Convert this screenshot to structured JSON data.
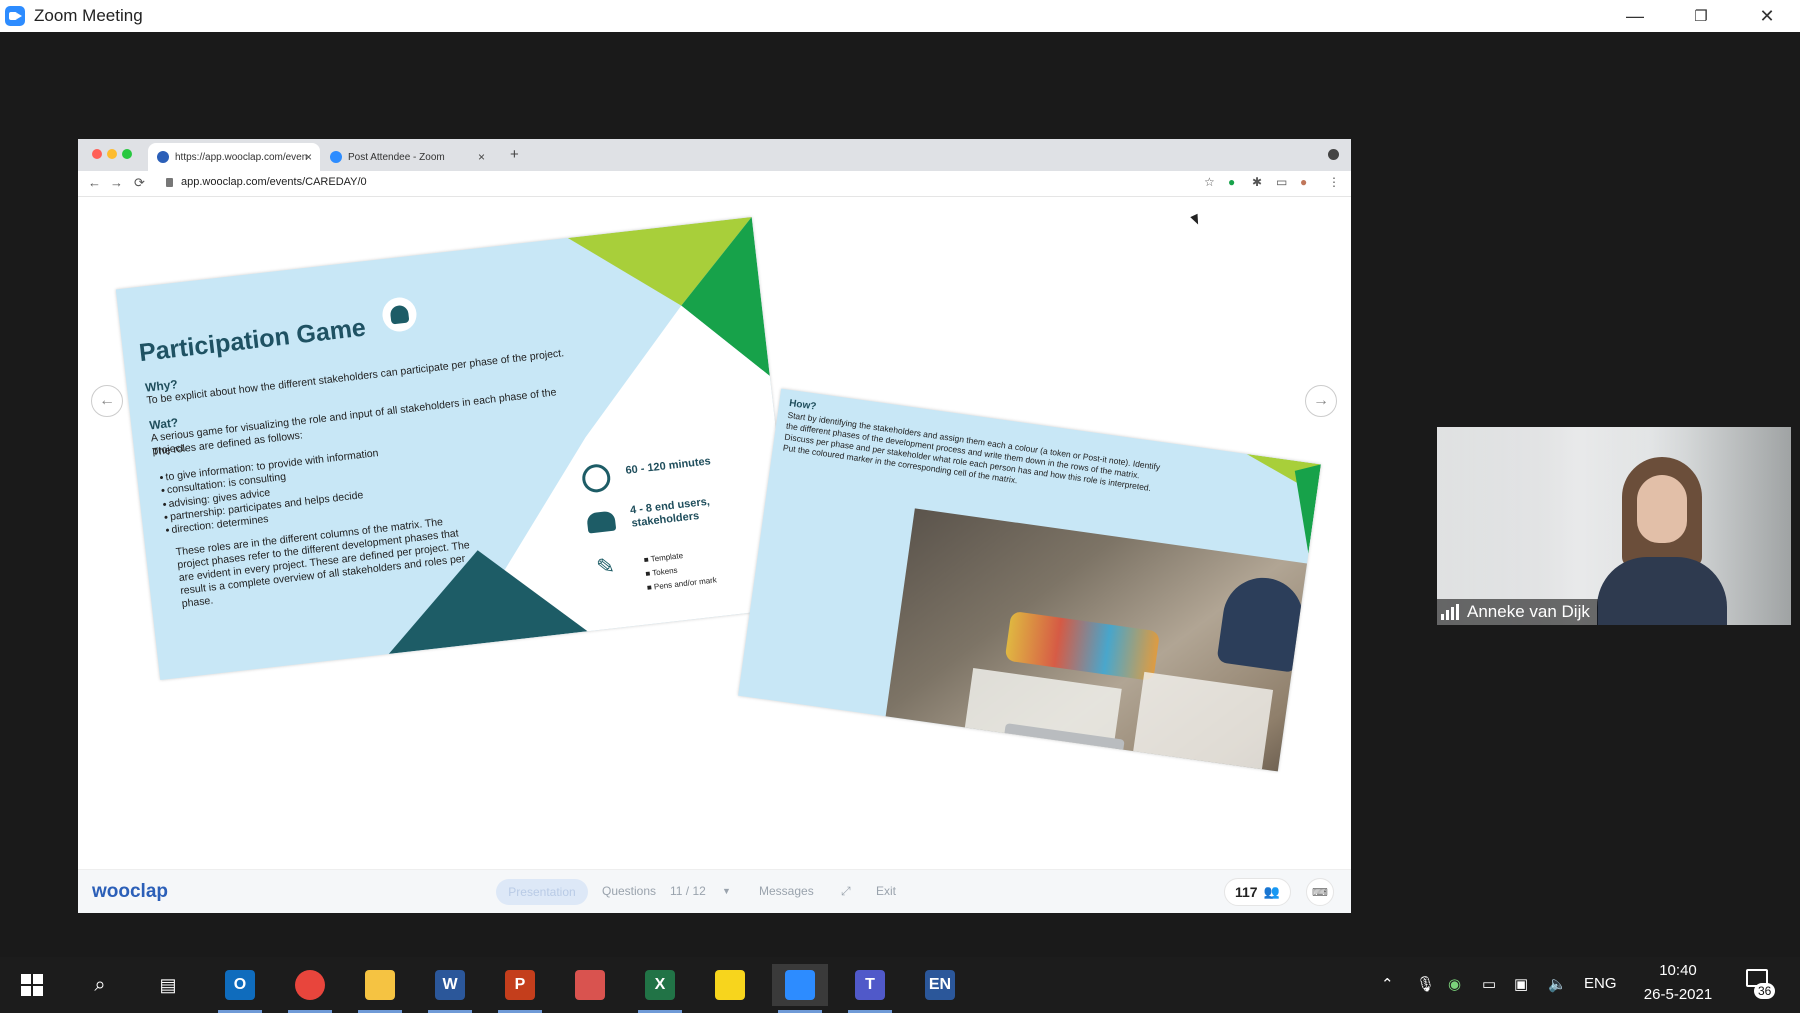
{
  "window": {
    "title": "Zoom Meeting",
    "minimize": "—",
    "restore": "❐",
    "close": "✕"
  },
  "browser": {
    "tabs": [
      {
        "label": "https://app.wooclap.com/even",
        "close": "×"
      },
      {
        "label": "Post Attendee - Zoom",
        "close": "×"
      }
    ],
    "new_tab": "+",
    "url": "app.wooclap.com/events/CAREDAY/0",
    "nav": {
      "back": "←",
      "forward": "→",
      "reload": "⟳"
    }
  },
  "slide1": {
    "title": "Participation Game",
    "why_title": "Why?",
    "why_text": "To be explicit about how the different stakeholders can participate per phase of the project.",
    "wat_title": "Wat?",
    "wat_text1": "A serious game for visualizing the role and input of all stakeholders in each phase of the project.",
    "wat_text2": "The roles are defined as follows:",
    "roles": [
      "to give information: to provide with information",
      "consultation: is consulting",
      "advising: gives advice",
      "partnership: participates and helps decide",
      "direction: determines"
    ],
    "matrix_text": "These roles are in the different columns of the matrix. The project phases refer to the different development phases that are evident in every project. These are defined per project. The result is a complete overview of all stakeholders and roles per phase.",
    "duration": "60 - 120 minutes",
    "users": "4 - 8 end users, stakeholders",
    "materials": [
      "Template",
      "Tokens",
      "Pens and/or mark"
    ]
  },
  "slide2": {
    "how_title": "How?",
    "how_text": "Start by identifying the stakeholders and assign them each a colour (a token or Post-it note). Identify the different phases of the development process and write them down in the rows of the matrix. Discuss per phase and per stakeholder what role each person has and how this role is interpreted. Put the coloured marker in the corresponding cell of the matrix."
  },
  "wooclap_bar": {
    "logo": "wooclap",
    "presentation": "Presentation",
    "questions": "Questions",
    "pagination": "11 / 12",
    "messages": "Messages",
    "exit": "Exit",
    "participants": "117"
  },
  "video": {
    "name": "Anneke van Dijk"
  },
  "taskbar": {
    "language": "ENG",
    "time": "10:40",
    "date": "26-5-2021",
    "notifications": "36",
    "apps": [
      {
        "name": "Outlook",
        "letter": "O",
        "color": "#0f6cbd"
      },
      {
        "name": "Chrome",
        "letter": "",
        "color": "#e8453c"
      },
      {
        "name": "File Explorer",
        "letter": "",
        "color": "#f5c342"
      },
      {
        "name": "Word",
        "letter": "W",
        "color": "#2b579a"
      },
      {
        "name": "PowerPoint",
        "letter": "P",
        "color": "#c43e1c"
      },
      {
        "name": "Snipping",
        "letter": "",
        "color": "#d9534f"
      },
      {
        "name": "Excel",
        "letter": "X",
        "color": "#217346"
      },
      {
        "name": "Sticky Notes",
        "letter": "",
        "color": "#f7d51d"
      },
      {
        "name": "Zoom",
        "letter": "",
        "color": "#2d8cff"
      },
      {
        "name": "Teams",
        "letter": "T",
        "color": "#5059c9"
      },
      {
        "name": "Language",
        "letter": "EN",
        "color": "#2b579a"
      }
    ]
  },
  "colors": {
    "accent": "#2b5fb8",
    "slide_blue": "#c8e7f6",
    "slide_green": "#17a24a",
    "slide_lime": "#a8cf3a",
    "slide_teal": "#1d5c66"
  }
}
